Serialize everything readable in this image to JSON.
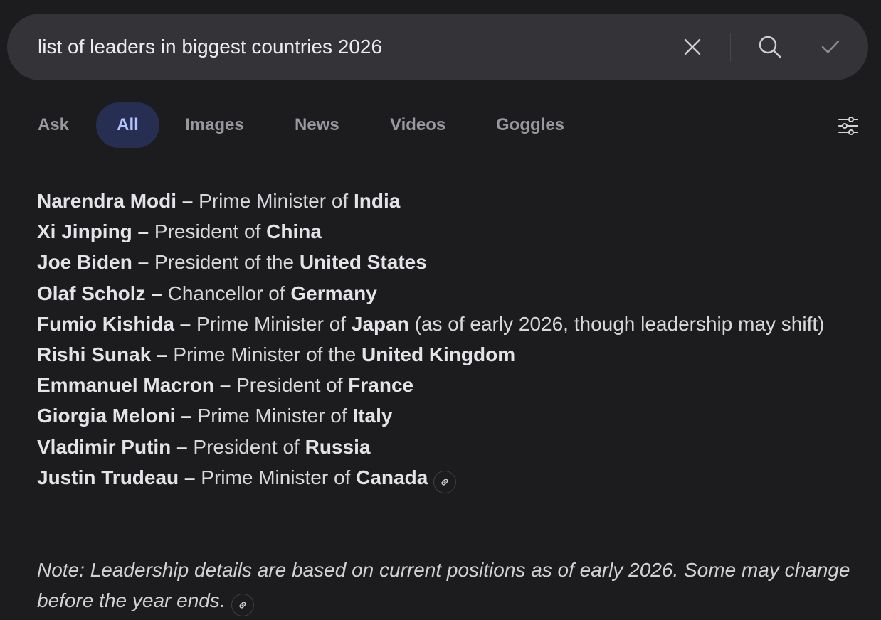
{
  "search": {
    "query": "list of leaders in biggest countries 2026",
    "clear_icon": "close-icon",
    "search_icon": "search-icon",
    "submit_icon": "check-icon"
  },
  "tabs": [
    {
      "label": "Ask",
      "active": false
    },
    {
      "label": "All",
      "active": true
    },
    {
      "label": "Images",
      "active": false
    },
    {
      "label": "News",
      "active": false
    },
    {
      "label": "Videos",
      "active": false
    },
    {
      "label": "Goggles",
      "active": false
    }
  ],
  "filter_icon": "sliders-icon",
  "colors": {
    "background": "#1c1c1e",
    "search_bar": "#333338",
    "active_tab_bg": "#262f52",
    "active_tab_text": "#b4c3ff",
    "inactive_tab_text": "#98989f"
  },
  "leaders": [
    {
      "name": "Narendra Modi",
      "sep": " – ",
      "role": "Prime Minister of ",
      "country": "India",
      "suffix": ""
    },
    {
      "name": "Xi Jinping",
      "sep": " – ",
      "role": "President of ",
      "country": "China",
      "suffix": ""
    },
    {
      "name": "Joe Biden",
      "sep": " – ",
      "role": "President of the ",
      "country": "United States",
      "suffix": ""
    },
    {
      "name": "Olaf Scholz",
      "sep": " – ",
      "role": "Chancellor of ",
      "country": "Germany",
      "suffix": ""
    },
    {
      "name": "Fumio Kishida",
      "sep": " – ",
      "role": "Prime Minister of ",
      "country": "Japan",
      "suffix": " (as of early 2026, though leadership may shift)"
    },
    {
      "name": "Rishi Sunak",
      "sep": " – ",
      "role": "Prime Minister of the ",
      "country": "United Kingdom",
      "suffix": ""
    },
    {
      "name": "Emmanuel Macron",
      "sep": " – ",
      "role": "President of ",
      "country": "France",
      "suffix": ""
    },
    {
      "name": "Giorgia Meloni",
      "sep": " – ",
      "role": "Prime Minister of ",
      "country": "Italy",
      "suffix": ""
    },
    {
      "name": "Vladimir Putin",
      "sep": " – ",
      "role": "President of ",
      "country": "Russia",
      "suffix": ""
    },
    {
      "name": "Justin Trudeau",
      "sep": " – ",
      "role": "Prime Minister of ",
      "country": "Canada",
      "suffix": ""
    }
  ],
  "note": "Note: Leadership details are based on current positions as of early 2026. Some may change before the year ends.",
  "link_icon": "link-icon"
}
